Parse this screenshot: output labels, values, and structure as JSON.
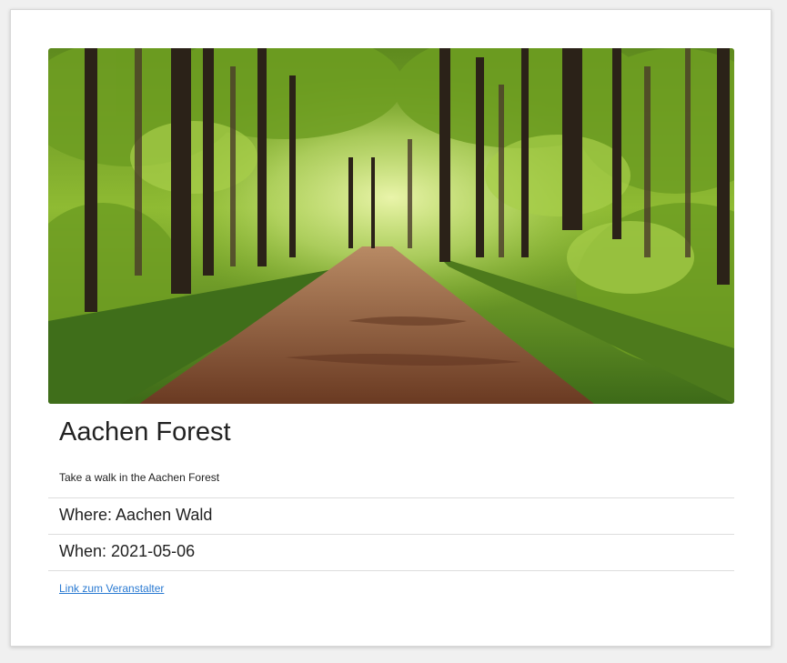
{
  "event": {
    "image_alt": "Forest path through green trees",
    "title": "Aachen Forest",
    "description": "Take a walk in the Aachen Forest",
    "where_label": "Where:",
    "where_value": "Aachen Wald",
    "when_label": "When:",
    "when_value": "2021-05-06",
    "link_text": "Link zum Veranstalter"
  },
  "colors": {
    "link": "#2a7ad2",
    "text": "#222222",
    "card_bg": "#ffffff"
  }
}
